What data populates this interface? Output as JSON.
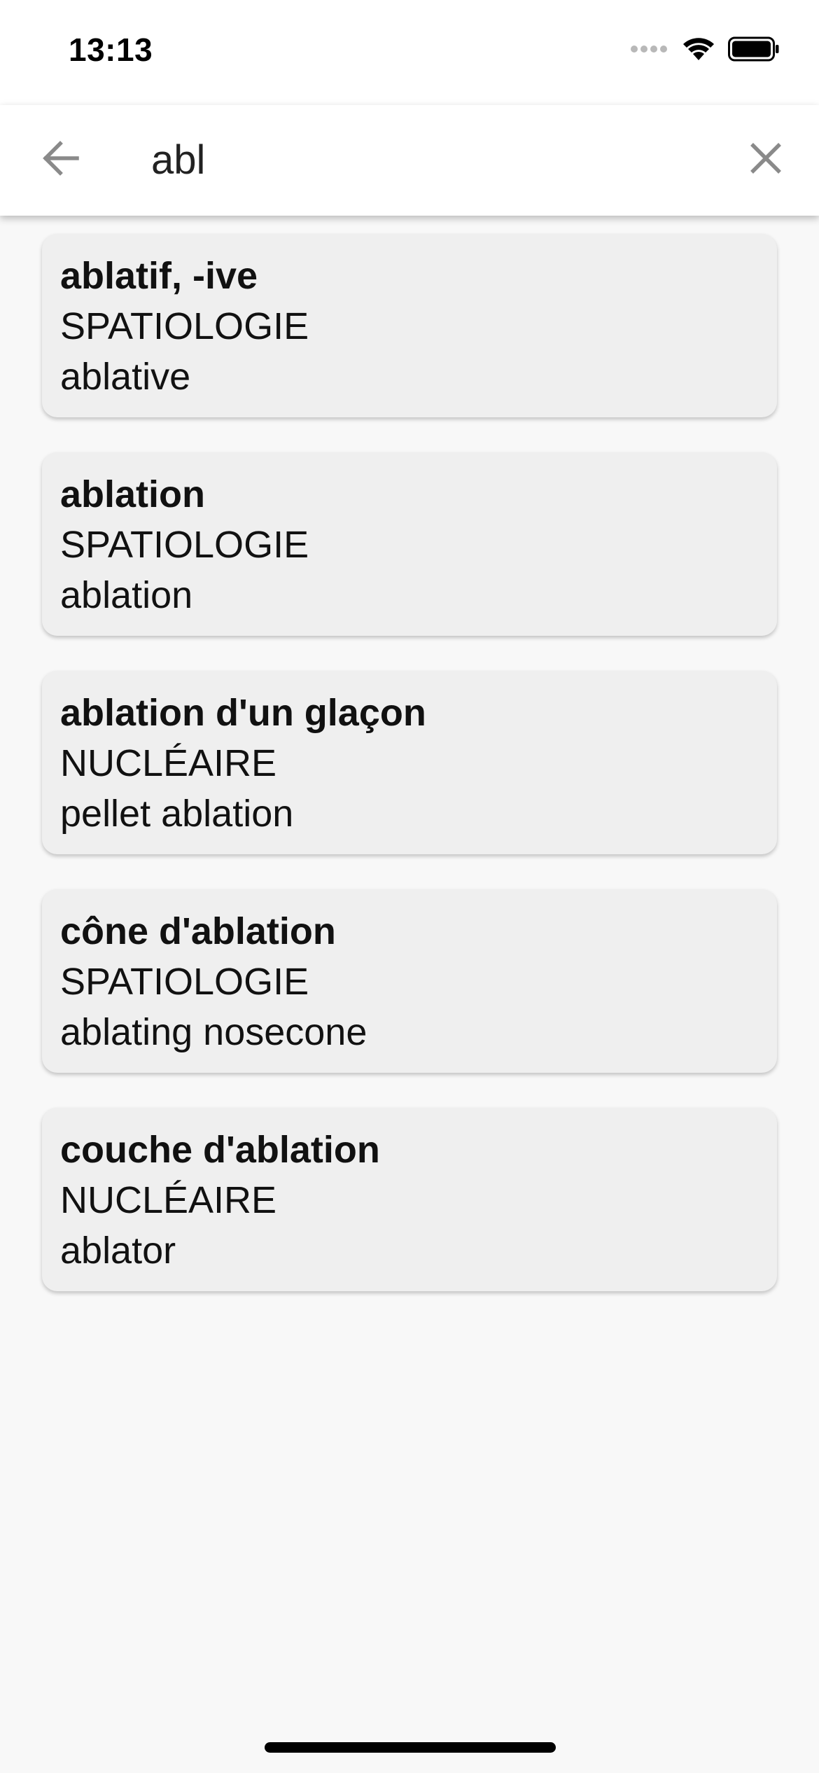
{
  "status_bar": {
    "time": "13:13",
    "icons": [
      "signal-dots-icon",
      "wifi-icon",
      "battery-icon"
    ]
  },
  "search": {
    "query": "abl",
    "back_icon": "arrow-left-icon",
    "clear_icon": "close-icon"
  },
  "results": [
    {
      "term": "ablatif, -ive",
      "domain": "SPATIOLOGIE",
      "translation": "ablative"
    },
    {
      "term": "ablation",
      "domain": "SPATIOLOGIE",
      "translation": "ablation"
    },
    {
      "term": "ablation d'un glaçon",
      "domain": "NUCLÉAIRE",
      "translation": "pellet ablation"
    },
    {
      "term": "cône d'ablation",
      "domain": "SPATIOLOGIE",
      "translation": "ablating nosecone"
    },
    {
      "term": "couche d'ablation",
      "domain": "NUCLÉAIRE",
      "translation": "ablator"
    }
  ],
  "colors": {
    "background": "#f8f8f8",
    "card": "#efefef",
    "icon_gray": "#8a8a8a"
  }
}
